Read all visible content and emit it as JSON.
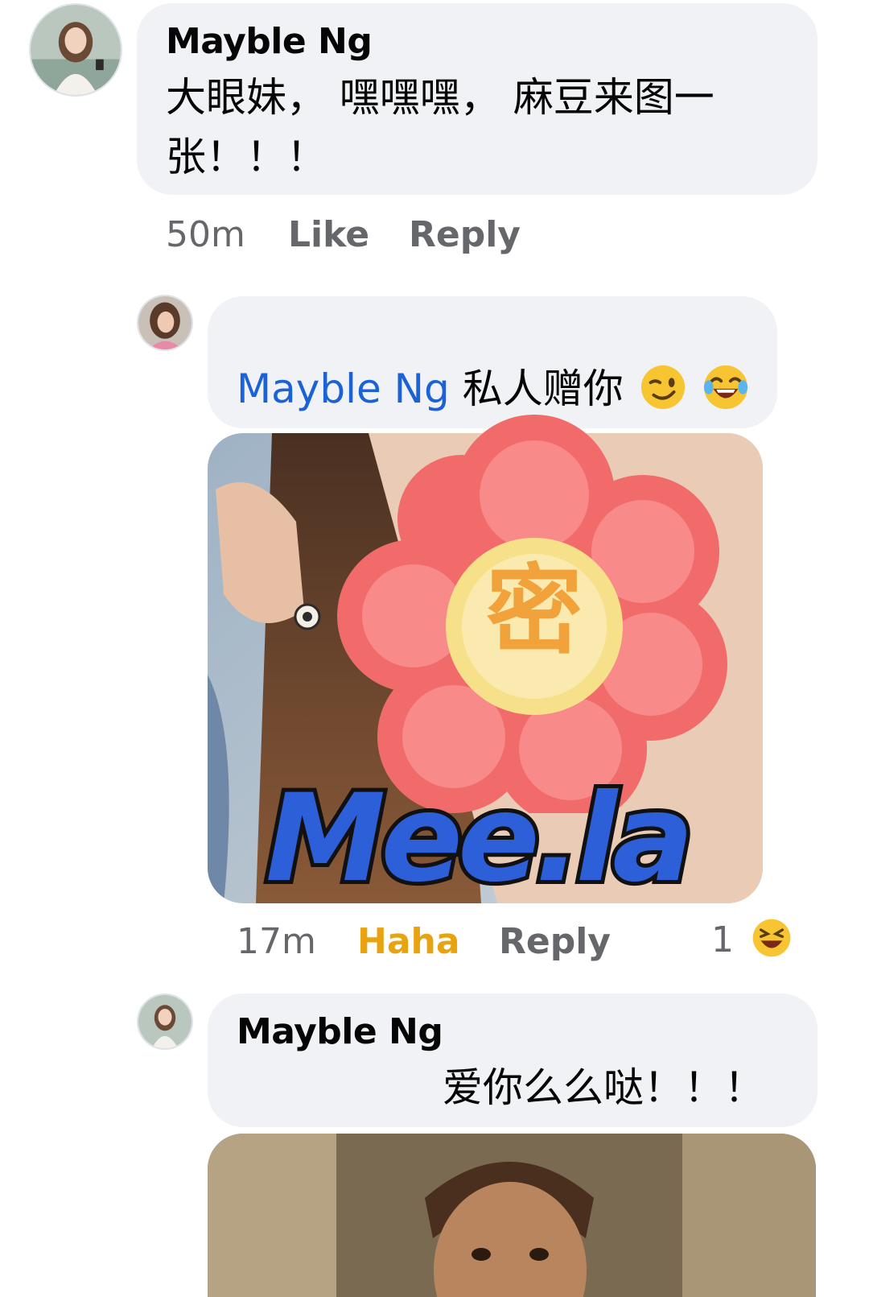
{
  "comments": [
    {
      "author": "Mayble Ng",
      "text_line1": "大眼妹， 嘿嘿嘿， 麻豆来图一",
      "text_line2": "张！！！",
      "time": "50m",
      "like_label": "Like",
      "reply_label": "Reply"
    },
    {
      "mention": "Mayble Ng",
      "text": "私人赠你",
      "emoji_1": "winking-face",
      "emoji_2": "tears-of-joy-face",
      "photo_watermark": "Mee.la",
      "photo_sticker_char": "密",
      "time": "17m",
      "reaction_label": "Haha",
      "reply_label": "Reply",
      "reaction_count": "1",
      "reaction_icon": "laughing-face"
    },
    {
      "author": "Mayble Ng",
      "text": "爱你么么哒！！！"
    }
  ],
  "colors": {
    "bubble": "#f0f2f5",
    "mention": "#1a62d6",
    "haha": "#e8a310",
    "meta": "#65676b",
    "watermark": "#2d5fd8"
  }
}
